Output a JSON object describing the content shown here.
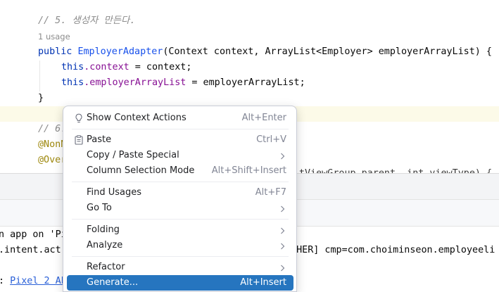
{
  "editor": {
    "comment_constructor": "// 5. 생성자 만든다.",
    "usages_hint": "1 usage",
    "line_sig": {
      "public": "public ",
      "class_name": "EmployerAdapter",
      "params": "(Context context, ArrayList<Employer> employerArrayList) {"
    },
    "line_ctx": {
      "this": "this",
      "field": ".context",
      "rest": " = context;"
    },
    "line_list": {
      "this": "this",
      "field": ".employerArrayList",
      "rest": " = employerArrayList;"
    },
    "line_close": "}",
    "comment_next": "// 6.",
    "ann_nonnull": "@NonN",
    "ann_override": "@Over",
    "partial_right": "tViewGroup parent, int viewType) {"
  },
  "console": {
    "line1": "n app on 'Pi",
    "line2": ".intent.act",
    "line2_right": "NCHER] cmp=com.choiminseon.employeeli",
    "line3_prefix": ": ",
    "line3_link": "Pixel 2 AP"
  },
  "context_menu": {
    "items": [
      {
        "label": "Show Context Actions",
        "shortcut": "Alt+Enter"
      },
      {
        "label": "Paste",
        "shortcut": "Ctrl+V"
      },
      {
        "label": "Copy / Paste Special",
        "shortcut": ""
      },
      {
        "label": "Column Selection Mode",
        "shortcut": "Alt+Shift+Insert"
      },
      {
        "label": "Find Usages",
        "shortcut": "Alt+F7"
      },
      {
        "label": "Go To",
        "shortcut": ""
      },
      {
        "label": "Folding",
        "shortcut": ""
      },
      {
        "label": "Analyze",
        "shortcut": ""
      },
      {
        "label": "Refactor",
        "shortcut": ""
      },
      {
        "label": "Generate...",
        "shortcut": "Alt+Insert"
      }
    ]
  },
  "colors": {
    "selection": "#2675bf",
    "keyword": "#0033b3",
    "class_name": "#1750eb",
    "field": "#871094",
    "annotation": "#9e880d",
    "comment": "#8c8c8c"
  }
}
